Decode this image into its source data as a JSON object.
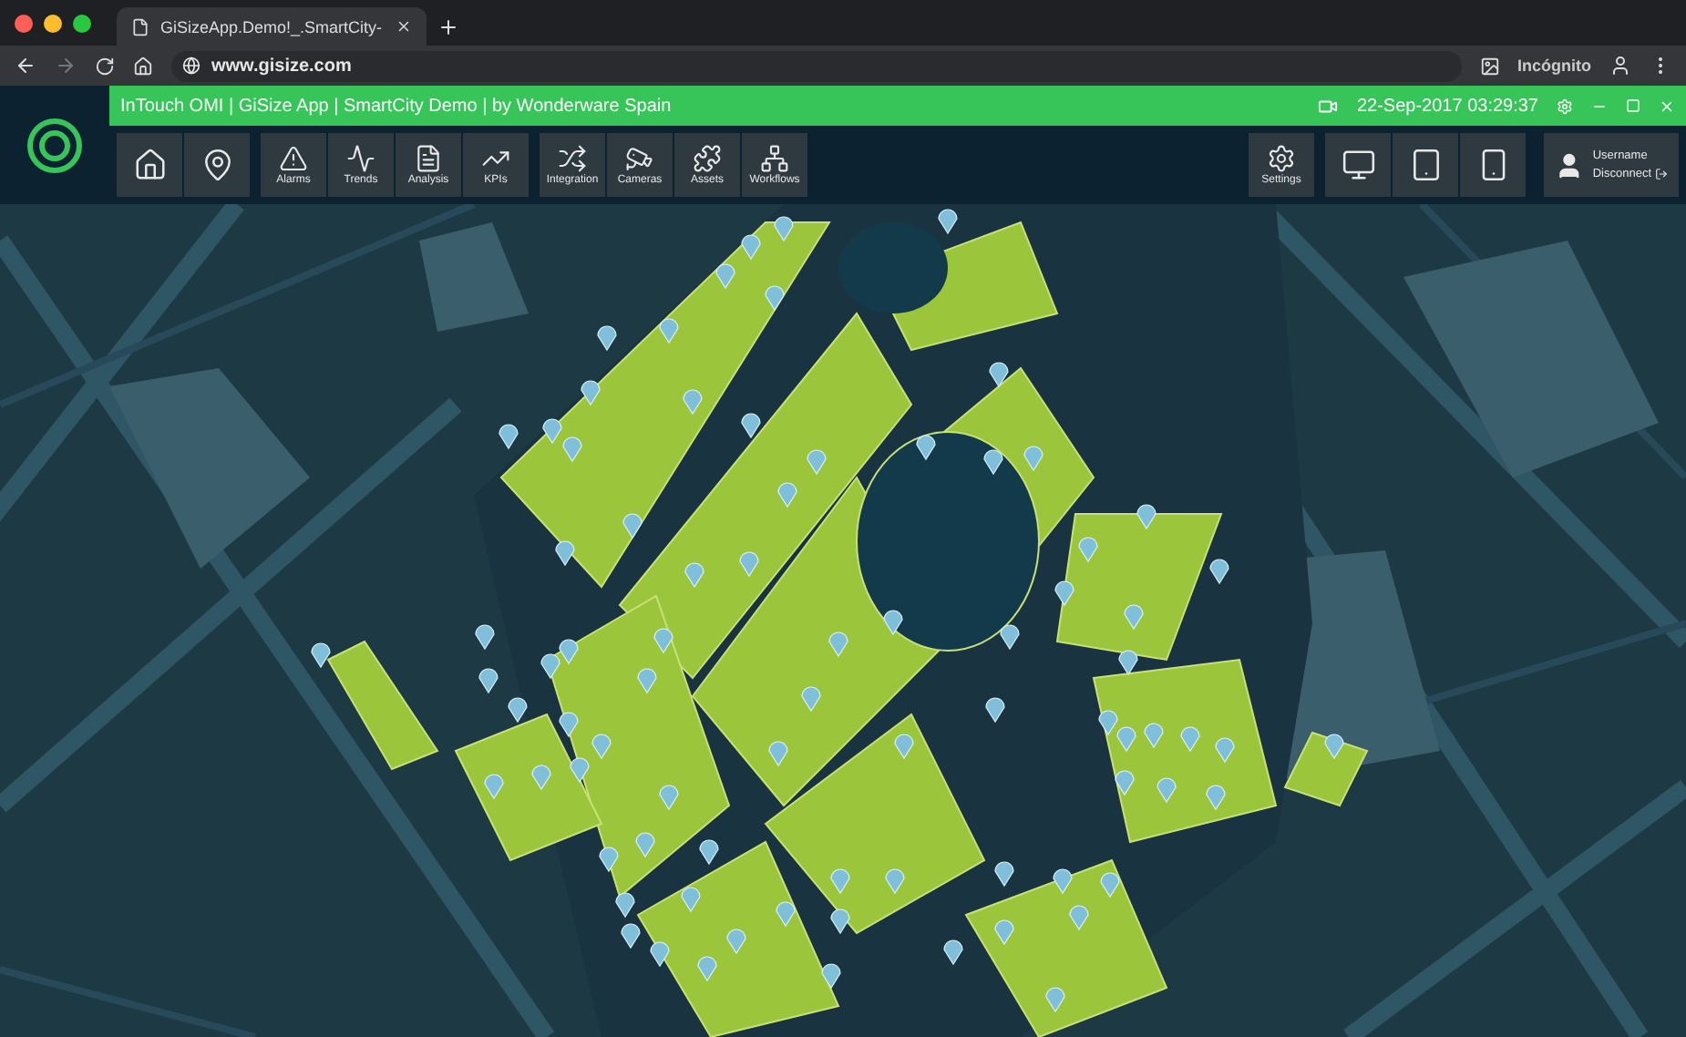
{
  "browser": {
    "tab_title": "GiSizeApp.Demo!_.SmartCity-",
    "url": "www.gisize.com",
    "profile": "Incógnito"
  },
  "app": {
    "title": "InTouch OMI | GiSize App | SmartCity Demo | by Wonderware Spain",
    "datetime": "22-Sep-2017 03:29:37"
  },
  "toolbar_groups": [
    {
      "buttons": [
        {
          "kind": "home"
        },
        {
          "kind": "location"
        }
      ]
    },
    {
      "buttons": [
        {
          "kind": "alarm",
          "label": "Alarms"
        },
        {
          "kind": "trends",
          "label": "Trends"
        },
        {
          "kind": "analysis",
          "label": "Analysis"
        },
        {
          "kind": "kpi",
          "label": "KPIs"
        }
      ]
    },
    {
      "buttons": [
        {
          "kind": "integration",
          "label": "Integration"
        },
        {
          "kind": "camera",
          "label": "Cameras"
        },
        {
          "kind": "assets",
          "label": "Assets"
        },
        {
          "kind": "workflow",
          "label": "Workflows"
        }
      ]
    }
  ],
  "right_groups": [
    {
      "buttons": [
        {
          "kind": "settings",
          "label": "Settings"
        }
      ]
    },
    {
      "buttons": [
        {
          "kind": "desktop"
        },
        {
          "kind": "tablet"
        },
        {
          "kind": "phone"
        }
      ]
    }
  ],
  "user": {
    "name": "Username",
    "action": "Disconnect"
  }
}
